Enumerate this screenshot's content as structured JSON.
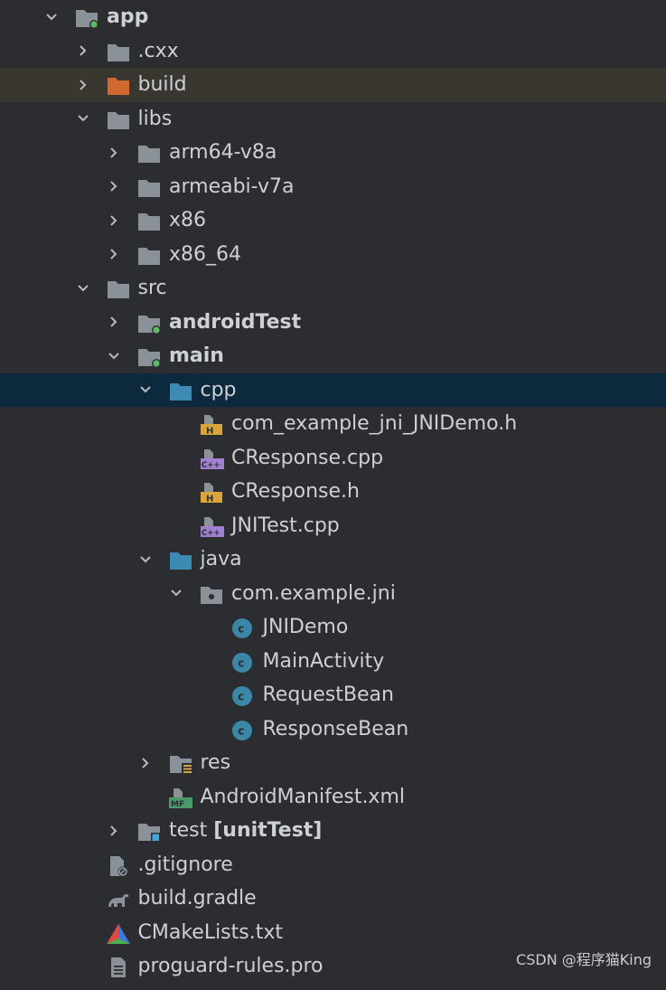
{
  "tree": [
    {
      "label": "app",
      "depth": 0,
      "arrow": "down",
      "icon": "module-folder",
      "bold": true
    },
    {
      "label": ".cxx",
      "depth": 1,
      "arrow": "right",
      "icon": "folder"
    },
    {
      "label": "build",
      "depth": 1,
      "arrow": "right",
      "icon": "folder-orange",
      "highlight": "build"
    },
    {
      "label": "libs",
      "depth": 1,
      "arrow": "down",
      "icon": "folder"
    },
    {
      "label": "arm64-v8a",
      "depth": 2,
      "arrow": "right",
      "icon": "folder"
    },
    {
      "label": "armeabi-v7a",
      "depth": 2,
      "arrow": "right",
      "icon": "folder"
    },
    {
      "label": "x86",
      "depth": 2,
      "arrow": "right",
      "icon": "folder"
    },
    {
      "label": "x86_64",
      "depth": 2,
      "arrow": "right",
      "icon": "folder"
    },
    {
      "label": "src",
      "depth": 1,
      "arrow": "down",
      "icon": "folder"
    },
    {
      "label": "androidTest",
      "depth": 2,
      "arrow": "right",
      "icon": "module-folder",
      "bold": true
    },
    {
      "label": "main",
      "depth": 2,
      "arrow": "down",
      "icon": "module-folder",
      "bold": true
    },
    {
      "label": "cpp",
      "depth": 3,
      "arrow": "down",
      "icon": "folder-blue",
      "highlight": "cpp"
    },
    {
      "label": "com_example_jni_JNIDemo.h",
      "depth": 4,
      "arrow": "none",
      "icon": "h-file"
    },
    {
      "label": "CResponse.cpp",
      "depth": 4,
      "arrow": "none",
      "icon": "cpp-file"
    },
    {
      "label": "CResponse.h",
      "depth": 4,
      "arrow": "none",
      "icon": "h-file"
    },
    {
      "label": "JNITest.cpp",
      "depth": 4,
      "arrow": "none",
      "icon": "cpp-file"
    },
    {
      "label": "java",
      "depth": 3,
      "arrow": "down",
      "icon": "folder-blue"
    },
    {
      "label": "com.example.jni",
      "depth": 4,
      "arrow": "down",
      "icon": "package"
    },
    {
      "label": "JNIDemo",
      "depth": 5,
      "arrow": "none",
      "icon": "class"
    },
    {
      "label": "MainActivity",
      "depth": 5,
      "arrow": "none",
      "icon": "class"
    },
    {
      "label": "RequestBean",
      "depth": 5,
      "arrow": "none",
      "icon": "class"
    },
    {
      "label": "ResponseBean",
      "depth": 5,
      "arrow": "none",
      "icon": "class"
    },
    {
      "label": "res",
      "depth": 3,
      "arrow": "right",
      "icon": "res-folder"
    },
    {
      "label": "AndroidManifest.xml",
      "depth": 3,
      "arrow": "none",
      "icon": "manifest"
    },
    {
      "label": "test ",
      "suffix": "[unitTest]",
      "depth": 2,
      "arrow": "right",
      "icon": "test-folder"
    },
    {
      "label": ".gitignore",
      "depth": 1,
      "arrow": "none",
      "icon": "gitignore"
    },
    {
      "label": "build.gradle",
      "depth": 1,
      "arrow": "none",
      "icon": "gradle"
    },
    {
      "label": "CMakeLists.txt",
      "depth": 1,
      "arrow": "none",
      "icon": "cmake"
    },
    {
      "label": "proguard-rules.pro",
      "depth": 1,
      "arrow": "none",
      "icon": "text-file"
    }
  ],
  "watermark": "CSDN @程序猫King",
  "colors": {
    "background": "#2b2d30",
    "text": "#cdd1d6",
    "folder": "#8a9199",
    "folder_orange": "#d0692f",
    "folder_blue": "#3d8ab5",
    "highlight_build": "#3a3630",
    "highlight_cpp": "#0d293e",
    "class_icon": "#3a87a8"
  }
}
